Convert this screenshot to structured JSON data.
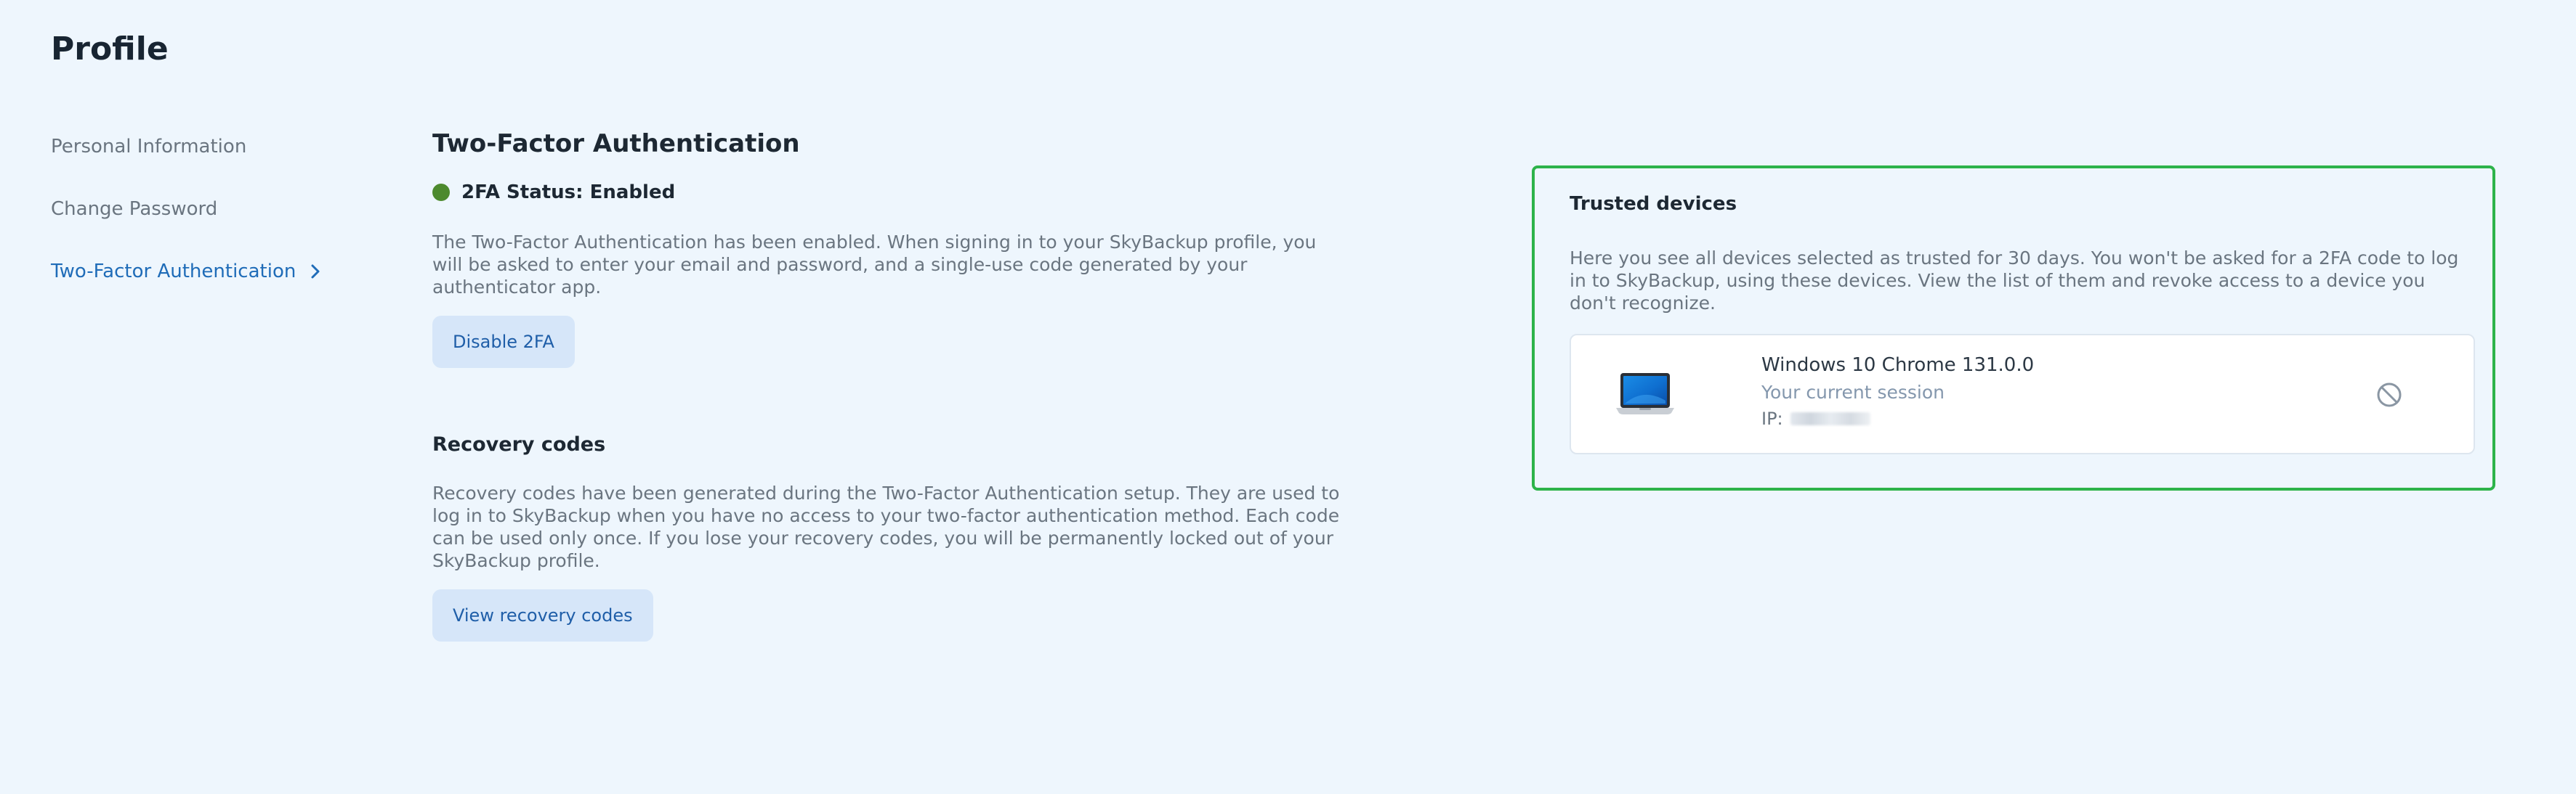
{
  "page": {
    "title": "Profile"
  },
  "sidebar": {
    "items": [
      {
        "label": "Personal Information",
        "active": false
      },
      {
        "label": "Change Password",
        "active": false
      },
      {
        "label": "Two-Factor Authentication",
        "active": true,
        "icon": "chevron-right-icon"
      }
    ]
  },
  "twofa": {
    "title": "Two-Factor Authentication",
    "status_label": "2FA Status: Enabled",
    "status_color": "#4d8a2e",
    "description": "The Two-Factor Authentication has been enabled. When signing in to your SkyBackup profile, you will be asked to enter your email and password, and a single-use code generated by your authenticator app.",
    "disable_button": "Disable 2FA"
  },
  "recovery": {
    "title": "Recovery codes",
    "description": "Recovery codes have been generated during the Two-Factor Authentication setup. They are used to log in to SkyBackup when you have no access to your two-factor authentication method. Each code can be used only once. If you lose your recovery codes, you will be permanently locked out of your SkyBackup profile.",
    "view_button": "View recovery codes"
  },
  "trusted_devices": {
    "title": "Trusted devices",
    "description": "Here you see all devices selected as trusted for 30 days. You won't be asked for a 2FA code to log in to SkyBackup, using these devices. View the list of them and revoke access to a device you don't recognize.",
    "border_color": "#2db34a",
    "devices": [
      {
        "icon": "laptop-icon",
        "name": "Windows 10 Chrome 131.0.0",
        "session": "Your current session",
        "ip_label": "IP:",
        "revoke_icon": "block-icon"
      }
    ]
  }
}
